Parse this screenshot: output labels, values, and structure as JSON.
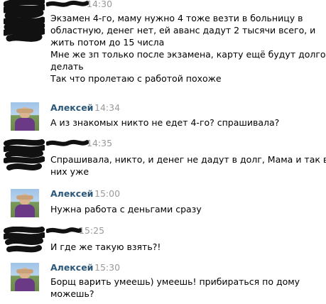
{
  "messages": [
    {
      "time": "14:30",
      "lines": [
        "Экзамен 4-го, маму нужно 4 тоже везти в больницу в",
        "областную, денег нет, ей аванс дадут 2 тысячи всего, и",
        "жить потом до 15 числа",
        "Мне же зп только после экзамена, карту ещё будут долго",
        "делать",
        "Так что пролетаю с работой похоже"
      ]
    },
    {
      "author": "Алексей",
      "time": "14:34",
      "lines": [
        "А из знакомых никто не едет 4-го? спрашивала?"
      ]
    },
    {
      "time": "14:35",
      "lines": [
        "Спрашивала, никто, и денег не дадут в долг, Мама и так в",
        "них уже"
      ]
    },
    {
      "author": "Алексей",
      "time": "15:00",
      "lines": [
        "Нужна работа с деньгами сразу"
      ]
    },
    {
      "time": "15:25",
      "lines": [
        "И где же такую взять?!"
      ]
    },
    {
      "author": "Алексей",
      "time": "15:30",
      "lines": [
        "Борщ варить умеешь) умеешь! прибираться по дому",
        "можешь?"
      ]
    }
  ],
  "colors": {
    "author_name": "#2b587a",
    "timestamp": "#999999",
    "text": "#000000",
    "censor_scribble": "#111111"
  }
}
